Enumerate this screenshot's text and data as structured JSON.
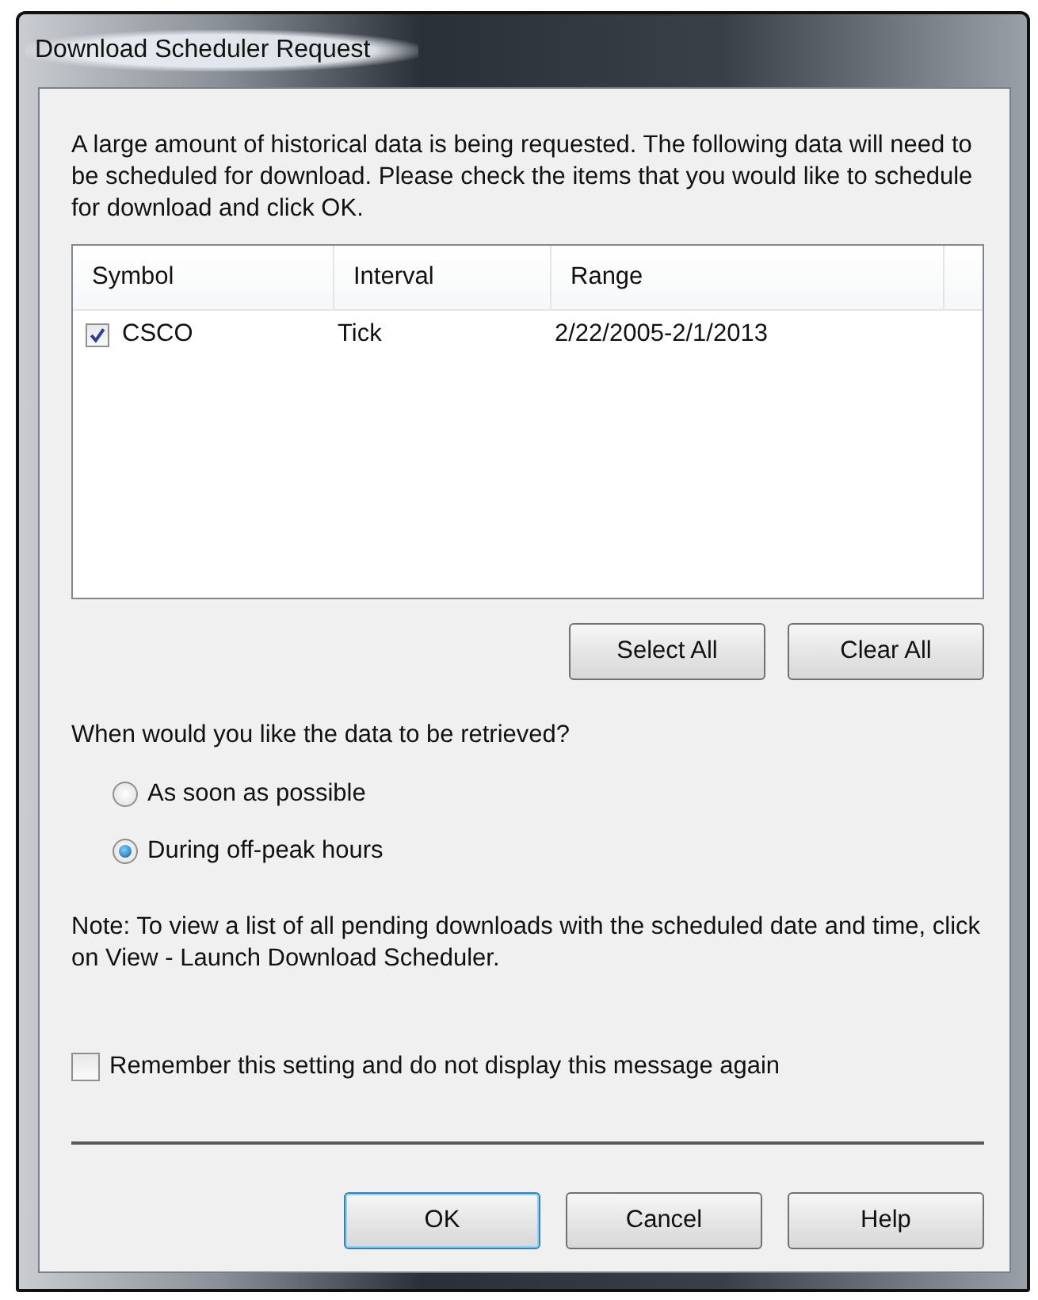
{
  "window": {
    "title": "Download Scheduler Request"
  },
  "message": "A large amount of historical data is being requested.  The following data will need to be scheduled for download.  Please check the items that you would like to schedule for download and click OK.",
  "table": {
    "columns": [
      "Symbol",
      "Interval",
      "Range"
    ],
    "rows": [
      {
        "checked": true,
        "cells": [
          "CSCO",
          "Tick",
          "2/22/2005-2/1/2013"
        ]
      }
    ]
  },
  "list_buttons": [
    "Select All",
    "Clear All"
  ],
  "question": "When would you like the data to be retrieved?",
  "options": [
    {
      "label": "As soon as possible",
      "selected": false
    },
    {
      "label": "During off-peak hours",
      "selected": true
    }
  ],
  "note": "Note:  To view a list of all pending downloads with the scheduled date and time, click on View - Launch Download Scheduler.",
  "remember": {
    "label": "Remember this setting and do not display this message again",
    "checked": false
  },
  "buttons": [
    {
      "label": "OK",
      "default": true
    },
    {
      "label": "Cancel",
      "default": false
    },
    {
      "label": "Help",
      "default": false
    }
  ]
}
